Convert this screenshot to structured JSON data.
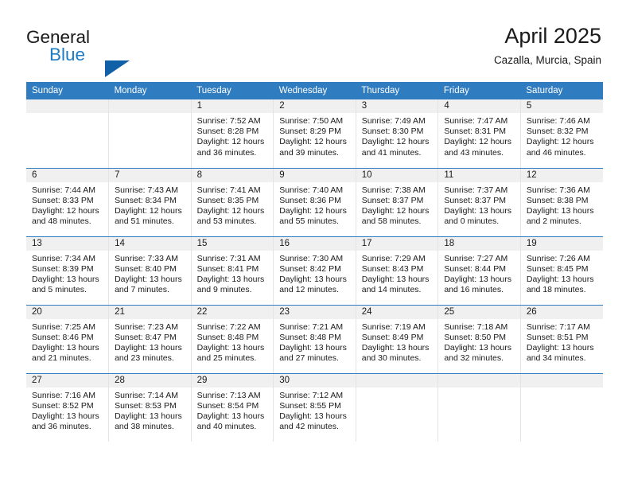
{
  "brand": {
    "name_part1": "General",
    "name_part2": "Blue",
    "flag_icon": "triangle-flag-icon",
    "accent_color": "#1d7cc4",
    "flag_color": "#1060a8"
  },
  "header": {
    "month_title": "April 2025",
    "location": "Cazalla, Murcia, Spain"
  },
  "calendar": {
    "header_color": "#2f7cc0",
    "daynum_bar_color": "#f0f0f0",
    "weekday_headers": [
      "Sunday",
      "Monday",
      "Tuesday",
      "Wednesday",
      "Thursday",
      "Friday",
      "Saturday"
    ],
    "weeks": [
      [
        {
          "day": "",
          "sunrise": "",
          "sunset": "",
          "daylight_line1": "",
          "daylight_line2": ""
        },
        {
          "day": "",
          "sunrise": "",
          "sunset": "",
          "daylight_line1": "",
          "daylight_line2": ""
        },
        {
          "day": "1",
          "sunrise": "Sunrise: 7:52 AM",
          "sunset": "Sunset: 8:28 PM",
          "daylight_line1": "Daylight: 12 hours",
          "daylight_line2": "and 36 minutes."
        },
        {
          "day": "2",
          "sunrise": "Sunrise: 7:50 AM",
          "sunset": "Sunset: 8:29 PM",
          "daylight_line1": "Daylight: 12 hours",
          "daylight_line2": "and 39 minutes."
        },
        {
          "day": "3",
          "sunrise": "Sunrise: 7:49 AM",
          "sunset": "Sunset: 8:30 PM",
          "daylight_line1": "Daylight: 12 hours",
          "daylight_line2": "and 41 minutes."
        },
        {
          "day": "4",
          "sunrise": "Sunrise: 7:47 AM",
          "sunset": "Sunset: 8:31 PM",
          "daylight_line1": "Daylight: 12 hours",
          "daylight_line2": "and 43 minutes."
        },
        {
          "day": "5",
          "sunrise": "Sunrise: 7:46 AM",
          "sunset": "Sunset: 8:32 PM",
          "daylight_line1": "Daylight: 12 hours",
          "daylight_line2": "and 46 minutes."
        }
      ],
      [
        {
          "day": "6",
          "sunrise": "Sunrise: 7:44 AM",
          "sunset": "Sunset: 8:33 PM",
          "daylight_line1": "Daylight: 12 hours",
          "daylight_line2": "and 48 minutes."
        },
        {
          "day": "7",
          "sunrise": "Sunrise: 7:43 AM",
          "sunset": "Sunset: 8:34 PM",
          "daylight_line1": "Daylight: 12 hours",
          "daylight_line2": "and 51 minutes."
        },
        {
          "day": "8",
          "sunrise": "Sunrise: 7:41 AM",
          "sunset": "Sunset: 8:35 PM",
          "daylight_line1": "Daylight: 12 hours",
          "daylight_line2": "and 53 minutes."
        },
        {
          "day": "9",
          "sunrise": "Sunrise: 7:40 AM",
          "sunset": "Sunset: 8:36 PM",
          "daylight_line1": "Daylight: 12 hours",
          "daylight_line2": "and 55 minutes."
        },
        {
          "day": "10",
          "sunrise": "Sunrise: 7:38 AM",
          "sunset": "Sunset: 8:37 PM",
          "daylight_line1": "Daylight: 12 hours",
          "daylight_line2": "and 58 minutes."
        },
        {
          "day": "11",
          "sunrise": "Sunrise: 7:37 AM",
          "sunset": "Sunset: 8:37 PM",
          "daylight_line1": "Daylight: 13 hours",
          "daylight_line2": "and 0 minutes."
        },
        {
          "day": "12",
          "sunrise": "Sunrise: 7:36 AM",
          "sunset": "Sunset: 8:38 PM",
          "daylight_line1": "Daylight: 13 hours",
          "daylight_line2": "and 2 minutes."
        }
      ],
      [
        {
          "day": "13",
          "sunrise": "Sunrise: 7:34 AM",
          "sunset": "Sunset: 8:39 PM",
          "daylight_line1": "Daylight: 13 hours",
          "daylight_line2": "and 5 minutes."
        },
        {
          "day": "14",
          "sunrise": "Sunrise: 7:33 AM",
          "sunset": "Sunset: 8:40 PM",
          "daylight_line1": "Daylight: 13 hours",
          "daylight_line2": "and 7 minutes."
        },
        {
          "day": "15",
          "sunrise": "Sunrise: 7:31 AM",
          "sunset": "Sunset: 8:41 PM",
          "daylight_line1": "Daylight: 13 hours",
          "daylight_line2": "and 9 minutes."
        },
        {
          "day": "16",
          "sunrise": "Sunrise: 7:30 AM",
          "sunset": "Sunset: 8:42 PM",
          "daylight_line1": "Daylight: 13 hours",
          "daylight_line2": "and 12 minutes."
        },
        {
          "day": "17",
          "sunrise": "Sunrise: 7:29 AM",
          "sunset": "Sunset: 8:43 PM",
          "daylight_line1": "Daylight: 13 hours",
          "daylight_line2": "and 14 minutes."
        },
        {
          "day": "18",
          "sunrise": "Sunrise: 7:27 AM",
          "sunset": "Sunset: 8:44 PM",
          "daylight_line1": "Daylight: 13 hours",
          "daylight_line2": "and 16 minutes."
        },
        {
          "day": "19",
          "sunrise": "Sunrise: 7:26 AM",
          "sunset": "Sunset: 8:45 PM",
          "daylight_line1": "Daylight: 13 hours",
          "daylight_line2": "and 18 minutes."
        }
      ],
      [
        {
          "day": "20",
          "sunrise": "Sunrise: 7:25 AM",
          "sunset": "Sunset: 8:46 PM",
          "daylight_line1": "Daylight: 13 hours",
          "daylight_line2": "and 21 minutes."
        },
        {
          "day": "21",
          "sunrise": "Sunrise: 7:23 AM",
          "sunset": "Sunset: 8:47 PM",
          "daylight_line1": "Daylight: 13 hours",
          "daylight_line2": "and 23 minutes."
        },
        {
          "day": "22",
          "sunrise": "Sunrise: 7:22 AM",
          "sunset": "Sunset: 8:48 PM",
          "daylight_line1": "Daylight: 13 hours",
          "daylight_line2": "and 25 minutes."
        },
        {
          "day": "23",
          "sunrise": "Sunrise: 7:21 AM",
          "sunset": "Sunset: 8:48 PM",
          "daylight_line1": "Daylight: 13 hours",
          "daylight_line2": "and 27 minutes."
        },
        {
          "day": "24",
          "sunrise": "Sunrise: 7:19 AM",
          "sunset": "Sunset: 8:49 PM",
          "daylight_line1": "Daylight: 13 hours",
          "daylight_line2": "and 30 minutes."
        },
        {
          "day": "25",
          "sunrise": "Sunrise: 7:18 AM",
          "sunset": "Sunset: 8:50 PM",
          "daylight_line1": "Daylight: 13 hours",
          "daylight_line2": "and 32 minutes."
        },
        {
          "day": "26",
          "sunrise": "Sunrise: 7:17 AM",
          "sunset": "Sunset: 8:51 PM",
          "daylight_line1": "Daylight: 13 hours",
          "daylight_line2": "and 34 minutes."
        }
      ],
      [
        {
          "day": "27",
          "sunrise": "Sunrise: 7:16 AM",
          "sunset": "Sunset: 8:52 PM",
          "daylight_line1": "Daylight: 13 hours",
          "daylight_line2": "and 36 minutes."
        },
        {
          "day": "28",
          "sunrise": "Sunrise: 7:14 AM",
          "sunset": "Sunset: 8:53 PM",
          "daylight_line1": "Daylight: 13 hours",
          "daylight_line2": "and 38 minutes."
        },
        {
          "day": "29",
          "sunrise": "Sunrise: 7:13 AM",
          "sunset": "Sunset: 8:54 PM",
          "daylight_line1": "Daylight: 13 hours",
          "daylight_line2": "and 40 minutes."
        },
        {
          "day": "30",
          "sunrise": "Sunrise: 7:12 AM",
          "sunset": "Sunset: 8:55 PM",
          "daylight_line1": "Daylight: 13 hours",
          "daylight_line2": "and 42 minutes."
        },
        {
          "day": "",
          "sunrise": "",
          "sunset": "",
          "daylight_line1": "",
          "daylight_line2": ""
        },
        {
          "day": "",
          "sunrise": "",
          "sunset": "",
          "daylight_line1": "",
          "daylight_line2": ""
        },
        {
          "day": "",
          "sunrise": "",
          "sunset": "",
          "daylight_line1": "",
          "daylight_line2": ""
        }
      ]
    ]
  }
}
